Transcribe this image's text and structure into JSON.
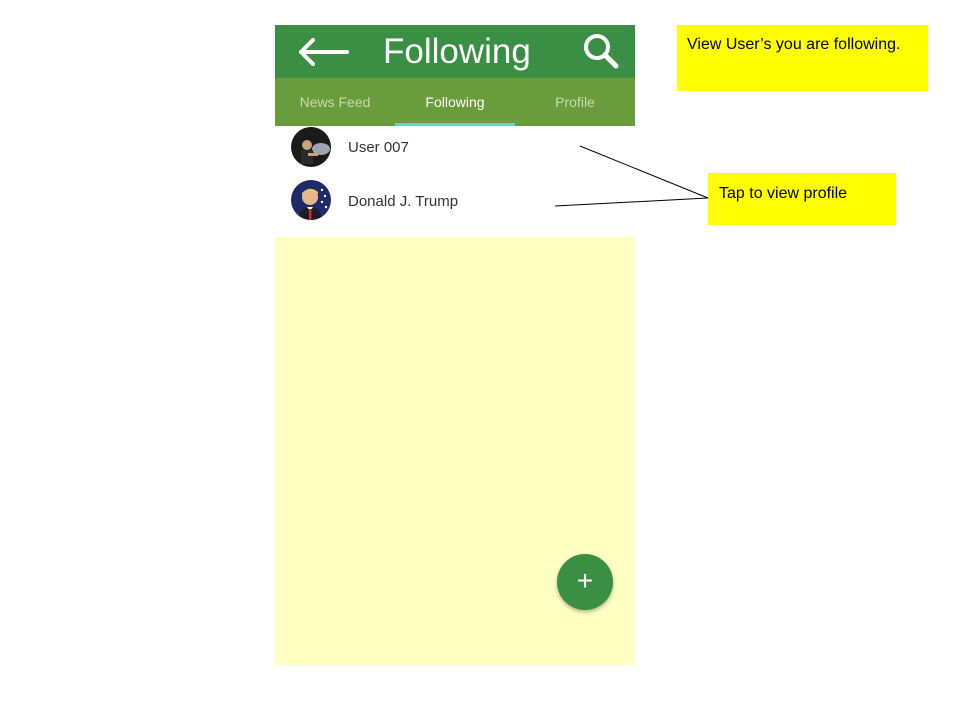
{
  "appbar": {
    "title": "Following",
    "back_icon": "arrow-left-icon",
    "search_icon": "search-icon",
    "color": "#3a8f44"
  },
  "tabs": [
    {
      "label": "News Feed",
      "active": false
    },
    {
      "label": "Following",
      "active": true
    },
    {
      "label": "Profile",
      "active": false
    }
  ],
  "tabs_color": "#699c3a",
  "tab_indicator_color": "#52e0c8",
  "following_list": [
    {
      "name": "User 007",
      "avatar": "user-007-avatar"
    },
    {
      "name": "Donald J. Trump",
      "avatar": "donald-trump-avatar"
    }
  ],
  "fab": {
    "label": "+",
    "icon": "plus-icon"
  },
  "background_color": "#ffffc2",
  "annotations": {
    "top_note": "View User’s you are following.",
    "tap_note": "Tap to view profile",
    "note_color": "#ffff00"
  }
}
